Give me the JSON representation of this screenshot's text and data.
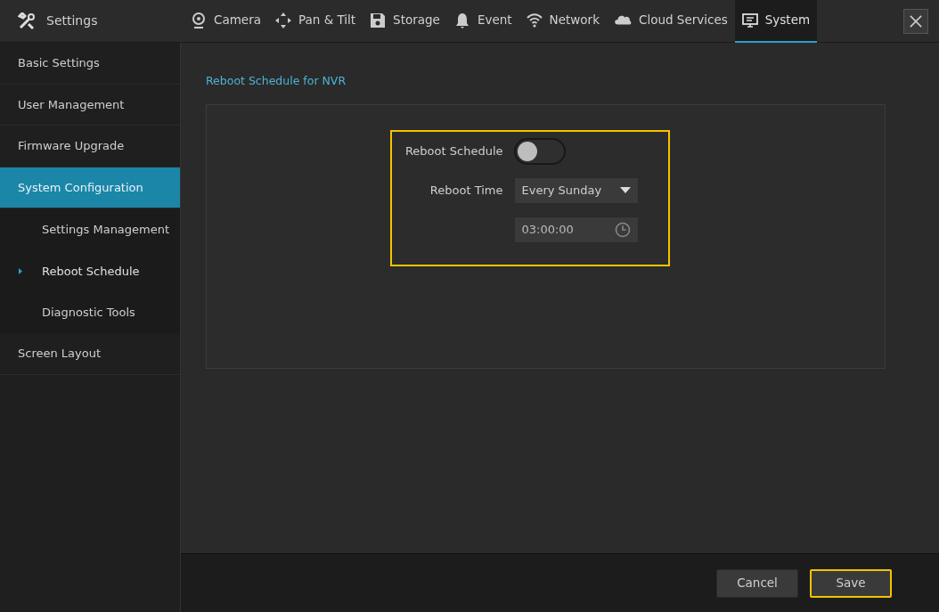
{
  "header": {
    "title": "Settings"
  },
  "tabs": [
    {
      "label": "Camera",
      "kind": "camera",
      "selected": false
    },
    {
      "label": "Pan & Tilt",
      "kind": "pantilt",
      "selected": false
    },
    {
      "label": "Storage",
      "kind": "storage",
      "selected": false
    },
    {
      "label": "Event",
      "kind": "bell",
      "selected": false
    },
    {
      "label": "Network",
      "kind": "wifi",
      "selected": false
    },
    {
      "label": "Cloud Services",
      "kind": "cloud",
      "selected": false
    },
    {
      "label": "System",
      "kind": "monitor",
      "selected": true
    }
  ],
  "sidebar": {
    "items": [
      {
        "label": "Basic Settings",
        "selected": false
      },
      {
        "label": "User Management",
        "selected": false
      },
      {
        "label": "Firmware Upgrade",
        "selected": false
      },
      {
        "label": "System Configuration",
        "selected": true,
        "children": [
          {
            "label": "Settings Management",
            "selected": false
          },
          {
            "label": "Reboot Schedule",
            "selected": true
          },
          {
            "label": "Diagnostic Tools",
            "selected": false
          }
        ]
      },
      {
        "label": "Screen Layout",
        "selected": false
      }
    ]
  },
  "section": {
    "title": "Reboot Schedule for NVR",
    "highlighted": true,
    "reboot_schedule": {
      "label": "Reboot Schedule",
      "on": false
    },
    "reboot_time": {
      "label": "Reboot Time",
      "value": "Every Sunday"
    },
    "time": {
      "value": "03:00:00"
    }
  },
  "buttons": [
    {
      "label": "Cancel",
      "highlighted": false
    },
    {
      "label": "Save",
      "highlighted": true
    }
  ]
}
